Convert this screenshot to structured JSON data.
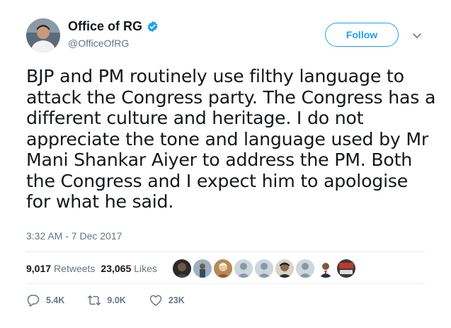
{
  "user": {
    "display_name": "Office of RG",
    "handle": "@OfficeOfRG",
    "verified": true
  },
  "follow_button": {
    "label": "Follow"
  },
  "tweet": {
    "lines": [
      "BJP and PM routinely use filthy language to",
      "attack the Congress party. The Congress has a",
      "different culture and heritage. I do not",
      "appreciate the tone and language used by Mr",
      "Mani Shankar Aiyer to address the PM. Both",
      "the Congress and I expect him to apologise",
      "for what he said."
    ],
    "timestamp": "3:32 AM - 7 Dec 2017"
  },
  "stats": {
    "retweets_count": "9,017",
    "retweets_label": "Retweets",
    "likes_count": "23,065",
    "likes_label": "Likes"
  },
  "actions": {
    "reply_count": "5.4K",
    "retweet_count": "9.0K",
    "like_count": "23K"
  },
  "colors": {
    "accent": "#1da1f2",
    "muted": "#657786",
    "text": "#14171a",
    "divider": "#e6ecf0"
  },
  "icons": [
    "verified-badge-icon",
    "chevron-down-icon",
    "reply-icon",
    "retweet-icon",
    "heart-icon"
  ]
}
